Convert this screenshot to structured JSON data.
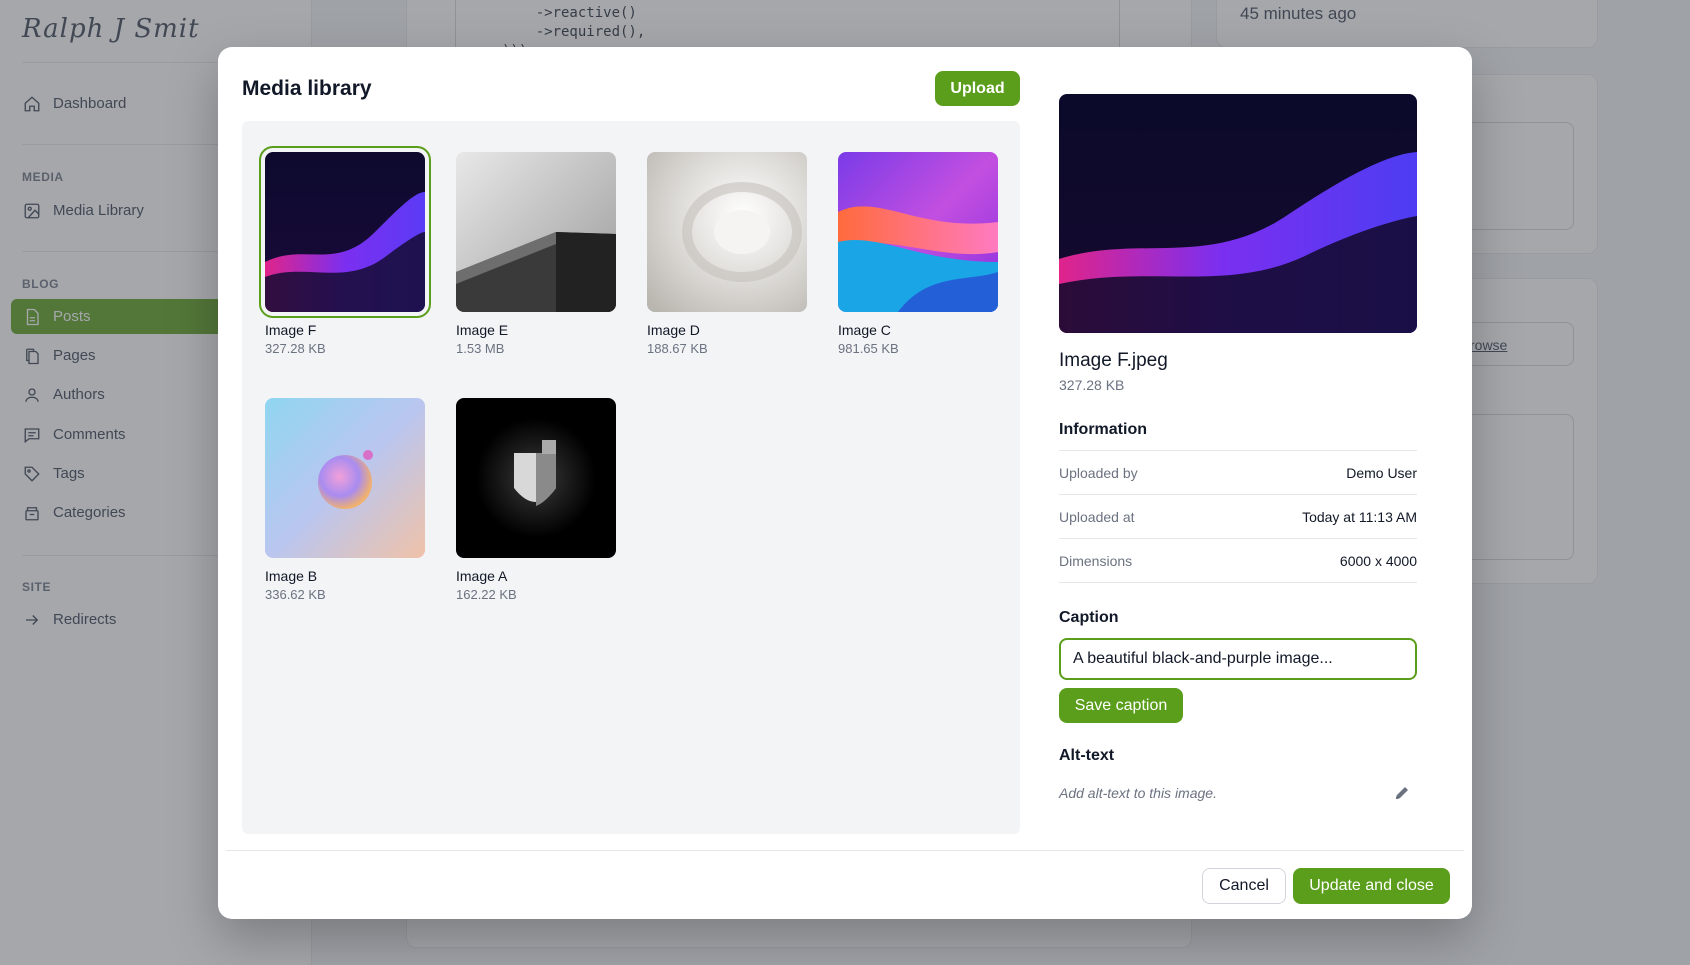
{
  "app": {
    "logo": "Ralph J Smit"
  },
  "sidebar": {
    "items": [
      {
        "label": "Dashboard",
        "icon": "home-icon"
      },
      {
        "label": "Media Library",
        "icon": "image-icon"
      },
      {
        "label": "Posts",
        "icon": "document-icon",
        "active": true
      },
      {
        "label": "Pages",
        "icon": "pages-icon"
      },
      {
        "label": "Authors",
        "icon": "users-icon"
      },
      {
        "label": "Comments",
        "icon": "chat-icon"
      },
      {
        "label": "Tags",
        "icon": "tag-icon"
      },
      {
        "label": "Categories",
        "icon": "archive-icon"
      },
      {
        "label": "Redirects",
        "icon": "arrow-right-icon"
      }
    ],
    "sections": {
      "media": "MEDIA",
      "blog": "BLOG",
      "site": "SITE"
    }
  },
  "background": {
    "code_line_1": "    ->reactive()",
    "code_line_2": "    ->required(),",
    "code_line_3": ")))",
    "time_ago": "45 minutes ago",
    "browse_link": "rowse"
  },
  "modal": {
    "title": "Media library",
    "upload_label": "Upload",
    "images": [
      {
        "name": "Image F",
        "size": "327.28 KB",
        "selected": true
      },
      {
        "name": "Image E",
        "size": "1.53 MB"
      },
      {
        "name": "Image D",
        "size": "188.67 KB"
      },
      {
        "name": "Image C",
        "size": "981.65 KB"
      },
      {
        "name": "Image B",
        "size": "336.62 KB"
      },
      {
        "name": "Image A",
        "size": "162.22 KB"
      }
    ],
    "details": {
      "file_name": "Image F.jpeg",
      "file_size": "327.28 KB",
      "info_title": "Information",
      "rows": [
        {
          "key": "Uploaded by",
          "value": "Demo User"
        },
        {
          "key": "Uploaded at",
          "value": "Today at 11:13 AM"
        },
        {
          "key": "Dimensions",
          "value": "6000 x 4000"
        }
      ],
      "caption_title": "Caption",
      "caption_value": "A beautiful black-and-purple image...",
      "save_caption_label": "Save caption",
      "alt_title": "Alt-text",
      "alt_hint": "Add alt-text to this image."
    },
    "cancel_label": "Cancel",
    "update_label": "Update and close"
  },
  "colors": {
    "accent": "#5a9e1b"
  }
}
